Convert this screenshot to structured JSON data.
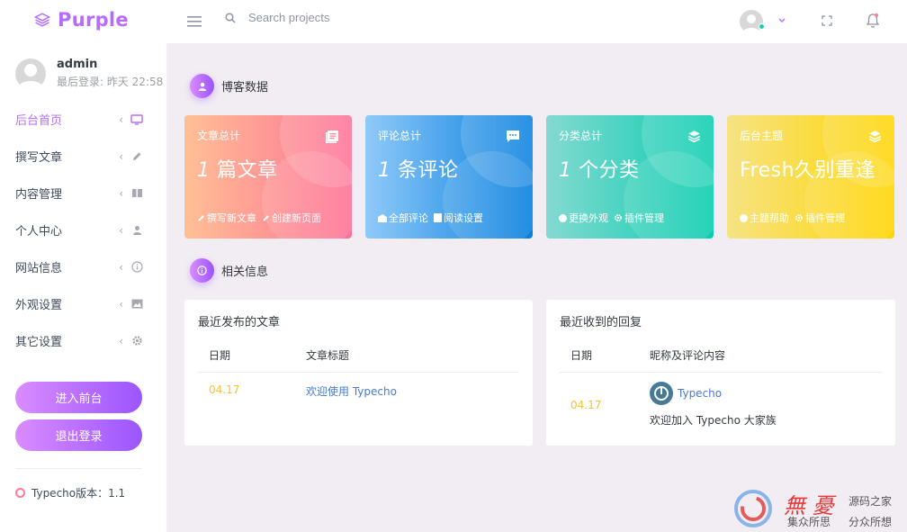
{
  "brand": {
    "name": "Purple"
  },
  "search": {
    "placeholder": "Search projects"
  },
  "sidebar": {
    "profile": {
      "name": "admin",
      "last_login": "最后登录: 昨天 22:58"
    },
    "items": [
      {
        "label": "后台首页",
        "icon": "monitor-icon",
        "active": true
      },
      {
        "label": "撰写文章",
        "icon": "pencil-icon"
      },
      {
        "label": "内容管理",
        "icon": "book-icon"
      },
      {
        "label": "个人中心",
        "icon": "user-icon"
      },
      {
        "label": "网站信息",
        "icon": "info-icon"
      },
      {
        "label": "外观设置",
        "icon": "image-icon"
      },
      {
        "label": "其它设置",
        "icon": "gear-icon"
      }
    ],
    "chevron": "‹",
    "buttons": {
      "frontend": "进入前台",
      "logout": "退出登录"
    },
    "version": "Typecho版本：1.1"
  },
  "sections": {
    "blog_data": "博客数据",
    "related": "相关信息"
  },
  "cards": [
    {
      "label": "文章总计",
      "number": "1",
      "unit": "篇文章",
      "links": [
        "撰写新文章",
        "创建新页面"
      ],
      "icon": "document-icon",
      "colors": [
        "#ffbf96",
        "#fe7096"
      ]
    },
    {
      "label": "评论总计",
      "number": "1",
      "unit": "条评论",
      "links": [
        "全部评论",
        "阅读设置"
      ],
      "icon": "comment-icon",
      "colors": [
        "#90caf9",
        "#047edf"
      ]
    },
    {
      "label": "分类总计",
      "number": "1",
      "unit": "个分类",
      "links": [
        "更换外观",
        "插件管理"
      ],
      "icon": "layers-icon",
      "colors": [
        "#84d9d2",
        "#07cdae"
      ]
    },
    {
      "label": "后台主题",
      "number": "",
      "unit": "Fresh久别重逢",
      "links": [
        "主题帮助",
        "插件管理"
      ],
      "icon": "layers-icon",
      "colors": [
        "#f6e384",
        "#ffd500"
      ]
    }
  ],
  "recent_posts": {
    "title": "最近发布的文章",
    "columns": [
      "日期",
      "文章标题"
    ],
    "rows": [
      {
        "date": "04.17",
        "title": "欢迎使用 Typecho"
      }
    ]
  },
  "recent_replies": {
    "title": "最近收到的回复",
    "columns": [
      "日期",
      "昵称及评论内容"
    ],
    "rows": [
      {
        "date": "04.17",
        "author": "Typecho",
        "content": "欢迎加入 Typecho 大家族"
      }
    ]
  },
  "watermark": {
    "site": "源码之家",
    "line1": "集众所思",
    "line2": "分众所想"
  },
  "colors": {
    "accent": "#b66dff",
    "date": "#f7c236",
    "link": "#4a7bcb"
  }
}
